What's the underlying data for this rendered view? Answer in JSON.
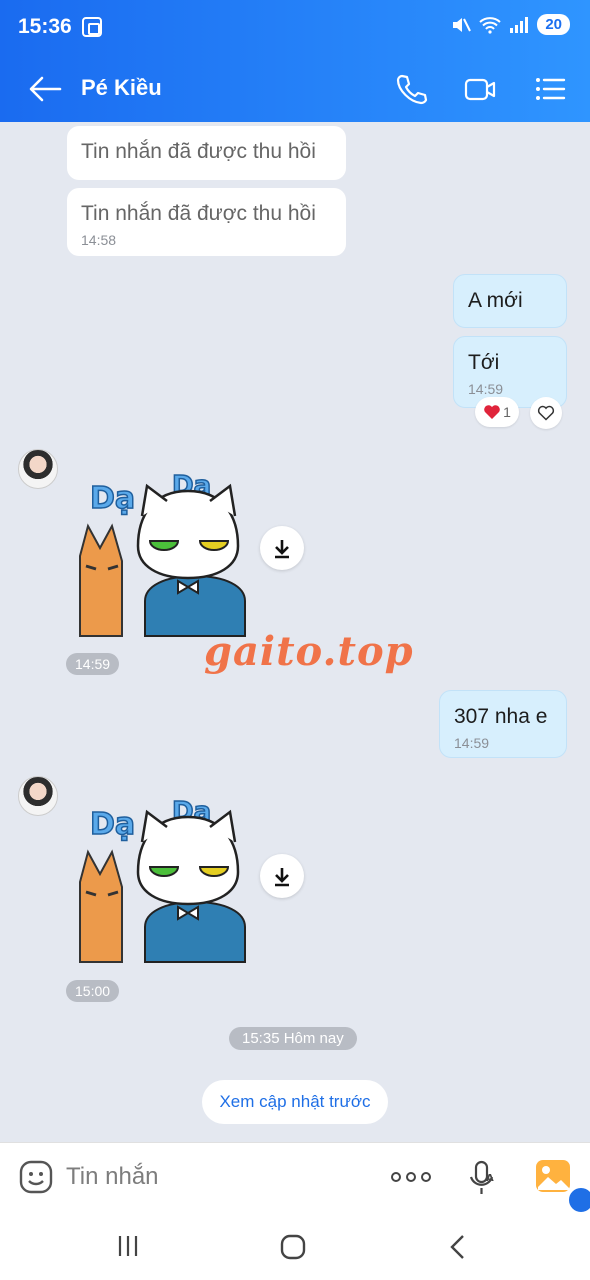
{
  "status_bar": {
    "time": "15:36",
    "battery": "20"
  },
  "header": {
    "contact_name": "Pé Kiều"
  },
  "messages": {
    "recalled_1": "Tin nhắn đã được thu hồi",
    "recalled_2": "Tin nhắn đã được thu hồi",
    "recalled_2_time": "14:58",
    "out_1": "A mới",
    "out_2": "Tới",
    "out_2_time": "14:59",
    "reaction_count": "1",
    "sticker_1_time": "14:59",
    "out_3": "307 nha e",
    "out_3_time": "14:59",
    "sticker_2_time": "15:00",
    "date_divider": "15:35 Hôm nay",
    "sticker_text_1": "Dạ",
    "sticker_text_2": "Dạ"
  },
  "watermark": "gaito.top",
  "history_button": "Xem cập nhật trước",
  "composer": {
    "placeholder": "Tin nhắn"
  },
  "colors": {
    "header_start": "#1a6bf0",
    "header_end": "#2f95ff",
    "out_bubble": "#d7effd",
    "accent": "#1f6fe6"
  }
}
